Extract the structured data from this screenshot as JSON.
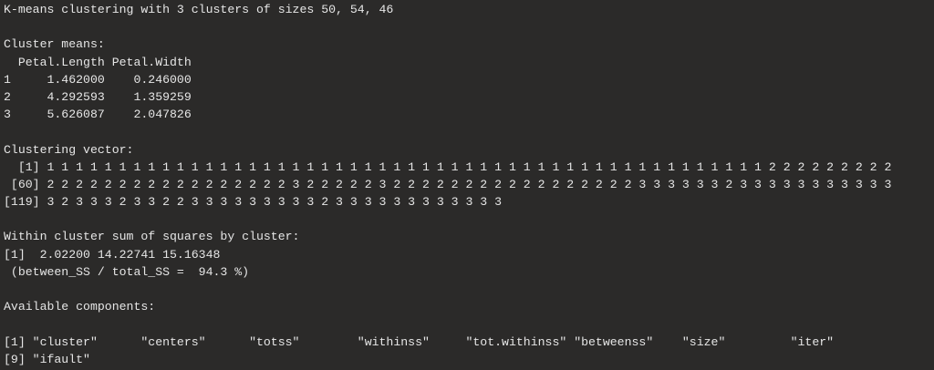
{
  "summary": "K-means clustering with 3 clusters of sizes 50, 54, 46",
  "means": {
    "title": "Cluster means:",
    "header": "  Petal.Length Petal.Width",
    "rows": [
      "1     1.462000    0.246000",
      "2     4.292593    1.359259",
      "3     5.626087    2.047826"
    ]
  },
  "vector": {
    "title": "Clustering vector:",
    "rows": [
      "  [1] 1 1 1 1 1 1 1 1 1 1 1 1 1 1 1 1 1 1 1 1 1 1 1 1 1 1 1 1 1 1 1 1 1 1 1 1 1 1 1 1 1 1 1 1 1 1 1 1 1 1 2 2 2 2 2 2 2 2 2",
      " [60] 2 2 2 2 2 2 2 2 2 2 2 2 2 2 2 2 2 3 2 2 2 2 2 3 2 2 2 2 2 2 2 2 2 2 2 2 2 2 2 2 2 3 3 3 3 3 3 2 3 3 3 3 3 3 3 3 3 3 3",
      "[119] 3 2 3 3 3 2 3 3 2 2 3 3 3 3 3 3 3 3 3 2 3 3 3 3 3 3 3 3 3 3 3 3"
    ]
  },
  "withinss": {
    "title": "Within cluster sum of squares by cluster:",
    "values": "[1]  2.02200 14.22741 15.16348",
    "ratio": " (between_SS / total_SS =  94.3 %)"
  },
  "components": {
    "title": "Available components:",
    "rows": [
      "[1] \"cluster\"      \"centers\"      \"totss\"        \"withinss\"     \"tot.withinss\" \"betweenss\"    \"size\"         \"iter\"",
      "[9] \"ifault\""
    ]
  }
}
